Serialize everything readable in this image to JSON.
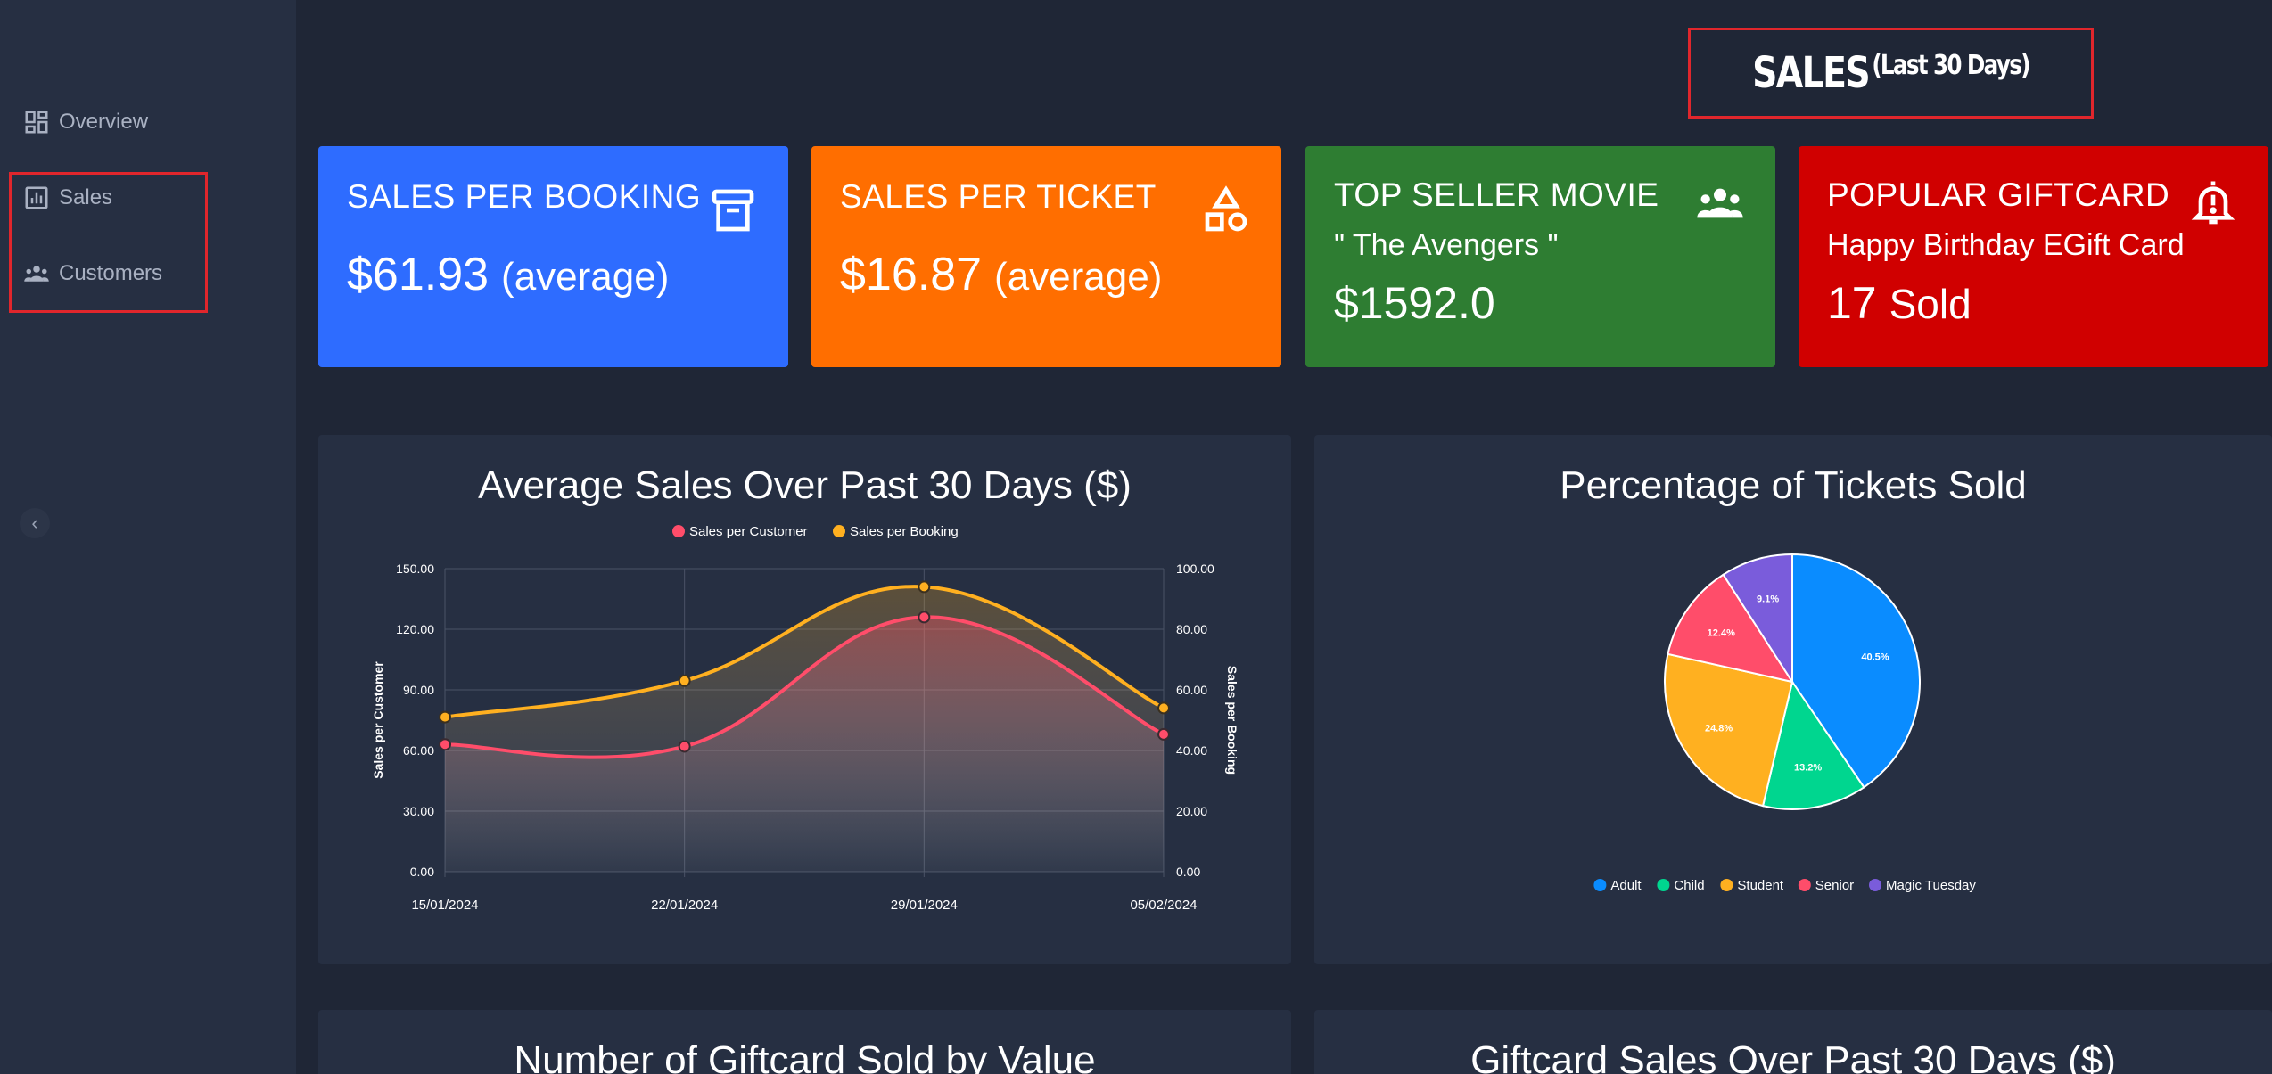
{
  "sidebar": {
    "items": [
      {
        "label": "Overview",
        "icon": "dashboard-icon"
      },
      {
        "label": "Sales",
        "icon": "bar-chart-icon"
      },
      {
        "label": "Customers",
        "icon": "people-icon"
      }
    ],
    "collapse_icon": "chevron-left-icon"
  },
  "header": {
    "title": "SALES",
    "subtitle": "(Last 30 Days)"
  },
  "cards": {
    "booking": {
      "title": "SALES PER BOOKING",
      "value": "$61.93",
      "note": "(average)",
      "icon": "archive-icon",
      "color": "#2e6cff"
    },
    "ticket": {
      "title": "SALES PER TICKET",
      "value": "$16.87",
      "note": "(average)",
      "icon": "shapes-icon",
      "color": "#ff6e00"
    },
    "movie": {
      "title": "TOP SELLER MOVIE",
      "name": "\" The Avengers \"",
      "value": "$1592.0",
      "icon": "people-icon",
      "color": "#2e7d32"
    },
    "giftcard": {
      "title": "POPULAR GIFTCARD",
      "name": "Happy Birthday EGift Card",
      "count": "17",
      "unit": "Sold",
      "icon": "bell-alert-icon",
      "color": "#d00000"
    }
  },
  "panels": {
    "avg_sales_title": "Average Sales Over Past 30 Days ($)",
    "tickets_title": "Percentage of Tickets Sold",
    "giftcard_count_title": "Number of Giftcard Sold by Value",
    "giftcard_sales_title": "Giftcard Sales Over Past 30 Days ($)"
  },
  "chart_data": [
    {
      "type": "line",
      "title": "Average Sales Over Past 30 Days ($)",
      "x": [
        "15/01/2024",
        "22/01/2024",
        "29/01/2024",
        "05/02/2024"
      ],
      "series": [
        {
          "name": "Sales per Customer",
          "values": [
            63,
            62,
            126,
            68
          ],
          "color": "#ff4d6a",
          "axis": "left"
        },
        {
          "name": "Sales per Booking",
          "values": [
            51,
            63,
            94,
            54
          ],
          "color": "#ffb020",
          "axis": "right"
        }
      ],
      "ylabel_left": "Sales per Customer",
      "ylabel_right": "Sales per Booking",
      "ylim_left": [
        0,
        150
      ],
      "ylim_right": [
        0,
        100
      ],
      "yticks_left": [
        "0.00",
        "30.00",
        "60.00",
        "90.00",
        "120.00",
        "150.00"
      ],
      "yticks_right": [
        "0.00",
        "20.00",
        "40.00",
        "60.00",
        "80.00",
        "100.00"
      ],
      "legend": "top",
      "grid": true
    },
    {
      "type": "pie",
      "title": "Percentage of Tickets Sold",
      "labels": [
        "Adult",
        "Child",
        "Student",
        "Senior",
        "Magic Tuesday"
      ],
      "values": [
        40.5,
        13.2,
        24.8,
        12.4,
        9.1
      ],
      "value_labels": [
        "40.5%",
        "13.2%",
        "24.8%",
        "12.4%",
        "9.1%"
      ],
      "colors": [
        "#0a8cff",
        "#00d68f",
        "#ffb020",
        "#ff4d6a",
        "#7a5cdb"
      ],
      "legend": "bottom"
    }
  ]
}
